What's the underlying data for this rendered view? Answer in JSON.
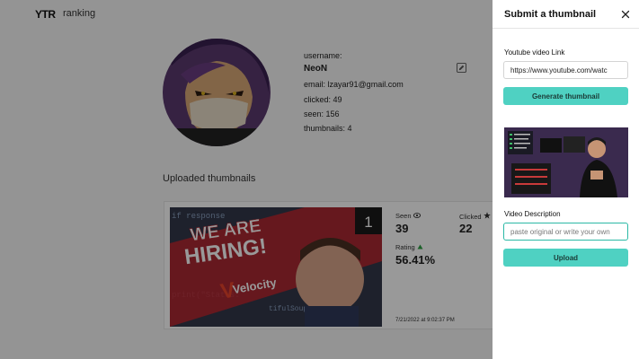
{
  "header": {
    "logo": "YTR",
    "nav_ranking": "ranking"
  },
  "profile": {
    "username_label": "username:",
    "username": "NeoN",
    "email_label": "email:",
    "email": "lzayar91@gmail.com",
    "clicked_label": "clicked:",
    "clicked": "49",
    "seen_label": "seen:",
    "seen": "156",
    "thumbnails_label": "thumbnails:",
    "thumbnails": "4"
  },
  "uploads": {
    "title": "Uploaded thumbnails",
    "items": [
      {
        "thumb_text_line1": "WE ARE",
        "thumb_text_line2": "HIRING!",
        "thumb_brand": "Velocity",
        "thumb_badge": "1",
        "seen_label": "Seen",
        "seen": "39",
        "clicked_label": "Clicked",
        "clicked": "22",
        "rating_label": "Rating",
        "rating": "56.41%",
        "date": "7/21/2022",
        "date_at": "at",
        "time": "9:02:37 PM"
      }
    ]
  },
  "panel": {
    "title": "Submit a thumbnail",
    "link_label": "Youtube video Link",
    "link_value": "https://www.youtube.com/watc",
    "generate_label": "Generate thumbnail",
    "description_label": "Video Description",
    "description_placeholder": "paste original or write your own",
    "upload_label": "Upload"
  },
  "colors": {
    "accent": "#4fd1c2",
    "rating_up": "#2ea043"
  }
}
